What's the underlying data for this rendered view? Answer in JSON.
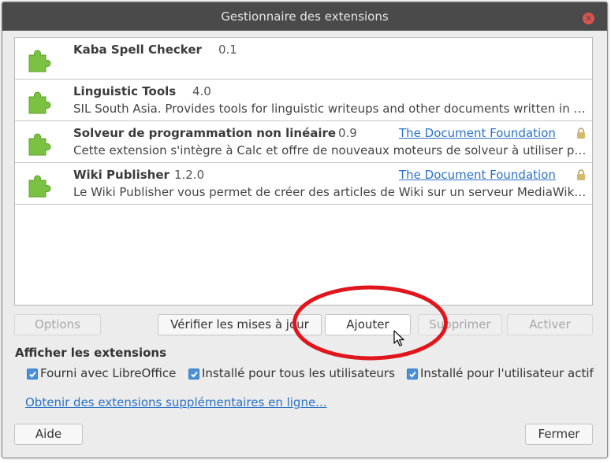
{
  "window": {
    "title": "Gestionnaire des extensions",
    "close_icon": "close-icon"
  },
  "extensions": [
    {
      "name": "Kaba Spell Checker",
      "version": "0.1",
      "description": "",
      "publisher": "",
      "locked": false,
      "icon": "puzzle-piece-icon"
    },
    {
      "name": "Linguistic Tools",
      "version": "4.0",
      "description": "SIL South Asia. Provides tools for linguistic writeups and other documents written in …",
      "publisher": "",
      "locked": false,
      "icon": "puzzle-piece-icon"
    },
    {
      "name": "Solveur de programmation non linéaire",
      "version": "0.9",
      "description": "Cette extension s'intègre à Calc et offre de nouveaux moteurs de solveur à utiliser p…",
      "publisher": "The Document Foundation",
      "locked": true,
      "icon": "puzzle-piece-icon"
    },
    {
      "name": "Wiki Publisher",
      "version": "1.2.0",
      "description": "Le Wiki Publisher vous permet de créer des articles de Wiki sur un serveur MediaWik…",
      "publisher": "The Document Foundation",
      "locked": true,
      "icon": "puzzle-piece-icon"
    }
  ],
  "buttons": {
    "options": "Options",
    "check_updates": "Vérifier les mises à jour",
    "add": "Ajouter",
    "remove": "Supprimer",
    "enable": "Activer",
    "help": "Aide",
    "close": "Fermer"
  },
  "filter": {
    "heading": "Afficher les extensions",
    "options": [
      {
        "label": "Fourni avec LibreOffice",
        "checked": true
      },
      {
        "label": "Installé pour tous les utilisateurs",
        "checked": true
      },
      {
        "label": "Installé pour l'utilisateur actif",
        "checked": true
      }
    ]
  },
  "online_link": "Obtenir des extensions supplémentaires en ligne...",
  "colors": {
    "titlebar": "#4a4a4a",
    "accent": "#4a90d9",
    "link": "#2a72c5",
    "icon_green": "#7cc242",
    "annotation_red": "#e0161c"
  }
}
